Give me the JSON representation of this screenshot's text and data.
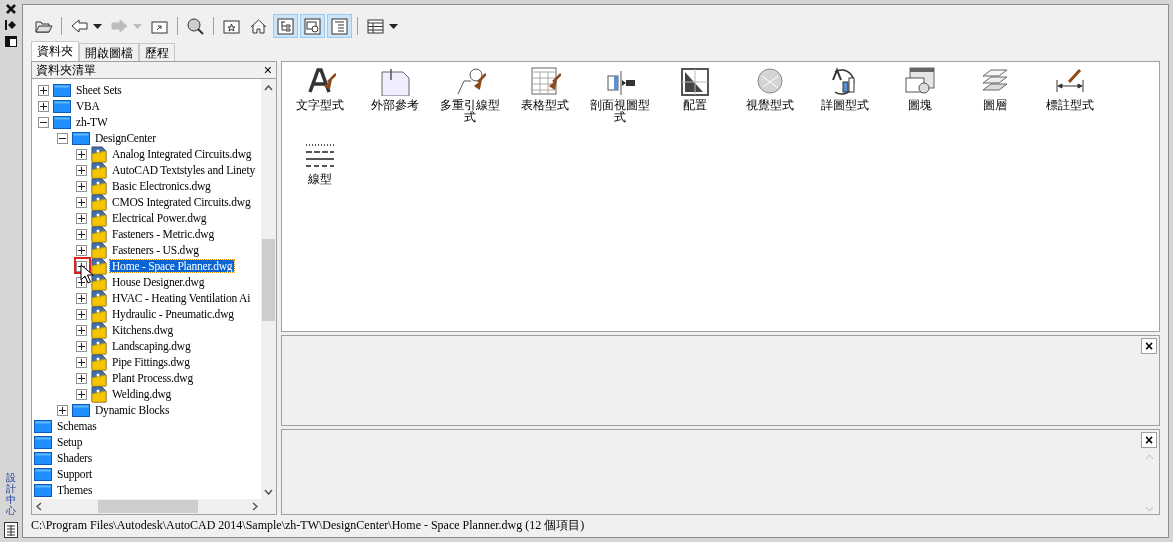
{
  "side_strip": {
    "title": "設計中心"
  },
  "toolbar": [
    {
      "kind": "button",
      "pressed": false,
      "dropdown": false,
      "disabled": false
    },
    {
      "kind": "separator"
    },
    {
      "kind": "button",
      "pressed": false,
      "dropdown": true,
      "disabled": false
    },
    {
      "kind": "button",
      "pressed": false,
      "dropdown": true,
      "disabled": true
    },
    {
      "kind": "button",
      "pressed": false,
      "dropdown": false,
      "disabled": false
    },
    {
      "kind": "separator"
    },
    {
      "kind": "button",
      "pressed": false,
      "dropdown": false,
      "disabled": false
    },
    {
      "kind": "separator"
    },
    {
      "kind": "button",
      "pressed": false,
      "dropdown": false,
      "disabled": false
    },
    {
      "kind": "button",
      "pressed": false,
      "dropdown": false,
      "disabled": false
    },
    {
      "kind": "button",
      "pressed": true,
      "dropdown": false,
      "disabled": false
    },
    {
      "kind": "button",
      "pressed": true,
      "dropdown": false,
      "disabled": false
    },
    {
      "kind": "button",
      "pressed": true,
      "dropdown": false,
      "disabled": false
    },
    {
      "kind": "separator"
    },
    {
      "kind": "button",
      "pressed": false,
      "dropdown": true,
      "disabled": false
    }
  ],
  "tabs": [
    {
      "label": "資料夾",
      "selected": true
    },
    {
      "label": "開啟圖檔",
      "selected": false
    },
    {
      "label": "歷程",
      "selected": false
    }
  ],
  "folder_panel": {
    "title": "資料夾清單",
    "close": "×",
    "tree": [
      {
        "label": "Sheet Sets",
        "kind": "folder",
        "expanded": false,
        "selected": false
      },
      {
        "label": "VBA",
        "kind": "folder",
        "expanded": false,
        "selected": false
      },
      {
        "label": "zh-TW",
        "kind": "folder",
        "expanded": true,
        "selected": false,
        "children": [
          {
            "label": "DesignCenter",
            "kind": "folder",
            "expanded": true,
            "selected": false,
            "children": [
              {
                "label": "Analog Integrated Circuits.dwg",
                "kind": "drawing",
                "expanded": false,
                "selected": false
              },
              {
                "label": "AutoCAD Textstyles and Linety",
                "kind": "drawing",
                "expanded": false,
                "selected": false
              },
              {
                "label": "Basic Electronics.dwg",
                "kind": "drawing",
                "expanded": false,
                "selected": false
              },
              {
                "label": "CMOS Integrated Circuits.dwg",
                "kind": "drawing",
                "expanded": false,
                "selected": false
              },
              {
                "label": "Electrical Power.dwg",
                "kind": "drawing",
                "expanded": false,
                "selected": false
              },
              {
                "label": "Fasteners - Metric.dwg",
                "kind": "drawing",
                "expanded": false,
                "selected": false
              },
              {
                "label": "Fasteners - US.dwg",
                "kind": "drawing",
                "expanded": false,
                "selected": false
              },
              {
                "label": "Home - Space Planner.dwg",
                "kind": "drawing",
                "expanded": false,
                "selected": true,
                "highlighted": true
              },
              {
                "label": "House Designer.dwg",
                "kind": "drawing",
                "expanded": false,
                "selected": false
              },
              {
                "label": "HVAC - Heating Ventilation Ai",
                "kind": "drawing",
                "expanded": false,
                "selected": false
              },
              {
                "label": "Hydraulic - Pneumatic.dwg",
                "kind": "drawing",
                "expanded": false,
                "selected": false
              },
              {
                "label": "Kitchens.dwg",
                "kind": "drawing",
                "expanded": false,
                "selected": false
              },
              {
                "label": "Landscaping.dwg",
                "kind": "drawing",
                "expanded": false,
                "selected": false
              },
              {
                "label": "Pipe Fittings.dwg",
                "kind": "drawing",
                "expanded": false,
                "selected": false
              },
              {
                "label": "Plant Process.dwg",
                "kind": "drawing",
                "expanded": false,
                "selected": false
              },
              {
                "label": "Welding.dwg",
                "kind": "drawing",
                "expanded": false,
                "selected": false
              }
            ]
          },
          {
            "label": "Dynamic Blocks",
            "kind": "folder",
            "expanded": false,
            "selected": false
          }
        ]
      },
      {
        "label": "Schemas",
        "kind": "leaf-folder",
        "selected": false
      },
      {
        "label": "Setup",
        "kind": "leaf-folder",
        "selected": false
      },
      {
        "label": "Shaders",
        "kind": "leaf-folder",
        "selected": false
      },
      {
        "label": "Support",
        "kind": "leaf-folder",
        "selected": false
      },
      {
        "label": "Themes",
        "kind": "leaf-folder",
        "selected": false
      }
    ]
  },
  "content_items": [
    {
      "label": "文字型式"
    },
    {
      "label": "外部參考"
    },
    {
      "label": "多重引線型式"
    },
    {
      "label": "表格型式"
    },
    {
      "label": "剖面視圖型式"
    },
    {
      "label": "配置"
    },
    {
      "label": "視覺型式"
    },
    {
      "label": "詳圖型式"
    },
    {
      "label": "圖塊"
    },
    {
      "label": "圖層"
    },
    {
      "label": "標註型式"
    },
    {
      "label": "線型"
    }
  ],
  "preview_panel": {
    "close": "×"
  },
  "description_panel": {
    "close": "×"
  },
  "status_bar": "C:\\Program Files\\Autodesk\\AutoCAD 2014\\Sample\\zh-TW\\DesignCenter\\Home - Space Planner.dwg (12 個項目)"
}
